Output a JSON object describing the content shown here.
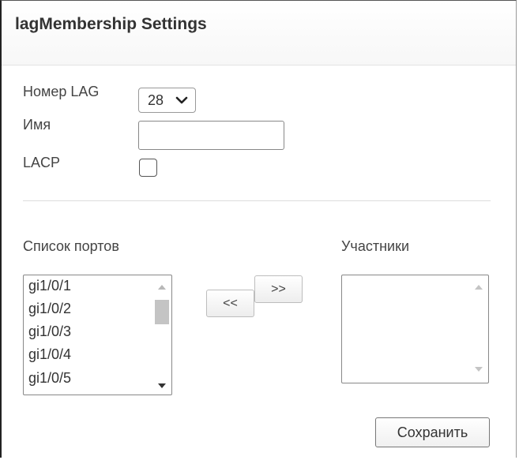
{
  "header": {
    "title": "lagMembership Settings"
  },
  "form": {
    "lag_number_label": "Номер LAG",
    "lag_number_value": "28",
    "name_label": "Имя",
    "name_value": "",
    "lacp_label": "LACP",
    "lacp_checked": false
  },
  "ports": {
    "label": "Список портов",
    "items": [
      "gi1/0/1",
      "gi1/0/2",
      "gi1/0/3",
      "gi1/0/4",
      "gi1/0/5"
    ]
  },
  "members": {
    "label": "Участники",
    "items": []
  },
  "buttons": {
    "move_right": ">>",
    "move_left": "<<",
    "save": "Сохранить"
  },
  "icons": {
    "dropdown": "chevron-down-icon",
    "scroll_up": "scroll-up-icon",
    "scroll_down": "scroll-down-icon"
  }
}
